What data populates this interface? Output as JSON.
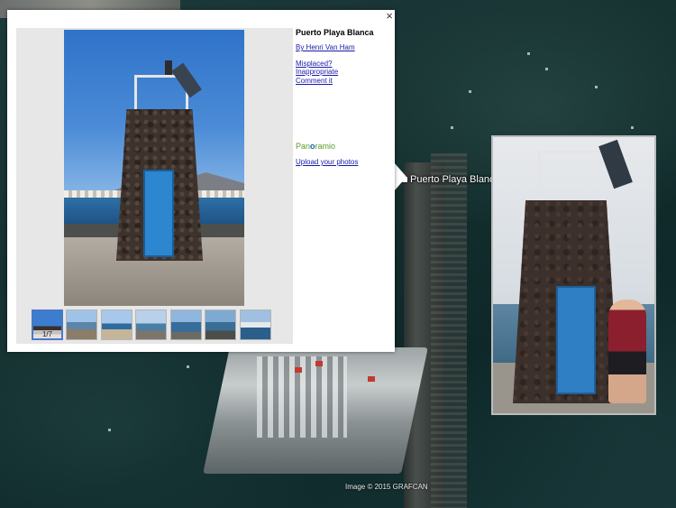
{
  "map": {
    "place_label": "Puerto Playa Blanca",
    "copyright": "Image © 2015 GRAFCAN"
  },
  "popup": {
    "close_glyph": "×",
    "title": "Puerto Playa Blanca",
    "author": "By Henri Van Ham",
    "links": [
      "Misplaced?",
      "Inappropriate",
      "Comment it"
    ],
    "logo": {
      "pre": "Pan",
      "mid": "o",
      "post": "ramio"
    },
    "upload": "Upload your photos",
    "photo_counter": "1/7"
  },
  "colors": {
    "link": "#1a1aa8",
    "logo_green": "#5a9b2c",
    "logo_blue": "#1a5fa8",
    "active_thumb_border": "#4a78c7"
  },
  "icons": [
    "close-icon"
  ]
}
